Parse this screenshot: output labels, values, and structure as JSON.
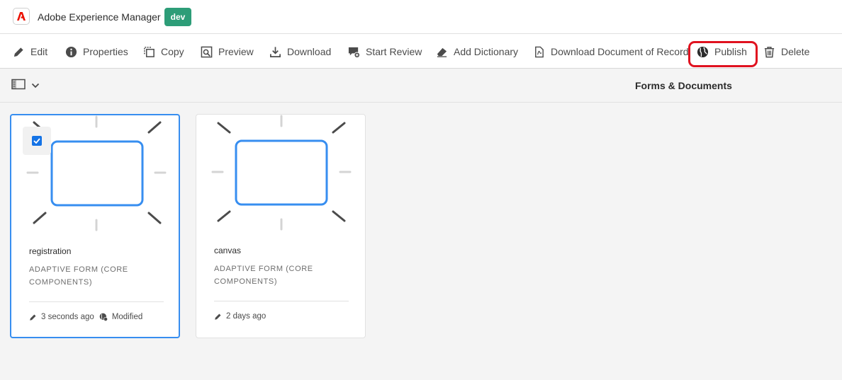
{
  "header": {
    "app_title": "Adobe Experience Manager",
    "env_badge": "dev",
    "logo_icon": "adobe-logo-icon",
    "brand_color": "#eb1000",
    "badge_color": "#2d9d78"
  },
  "actions": [
    {
      "label": "Edit",
      "icon": "pencil-icon"
    },
    {
      "label": "Properties",
      "icon": "info-icon"
    },
    {
      "label": "Copy",
      "icon": "copy-icon"
    },
    {
      "label": "Preview",
      "icon": "preview-icon"
    },
    {
      "label": "Download",
      "icon": "download-icon"
    },
    {
      "label": "Start Review",
      "icon": "review-icon"
    },
    {
      "label": "Add Dictionary",
      "icon": "eraser-icon"
    },
    {
      "label": "Download Document of Record",
      "icon": "document-icon"
    },
    {
      "label": "Publish",
      "icon": "globe-icon",
      "highlighted": true
    },
    {
      "label": "Delete",
      "icon": "trash-icon"
    }
  ],
  "highlight_color": "#e0121f",
  "railbar": {
    "section_title": "Forms & Documents"
  },
  "cards": [
    {
      "name": "registration",
      "type": "ADAPTIVE FORM (CORE COMPONENTS)",
      "modified_time": "3 seconds ago",
      "status": "Modified",
      "selected": true
    },
    {
      "name": "canvas",
      "type": "ADAPTIVE FORM (CORE COMPONENTS)",
      "modified_time": "2 days ago",
      "status": "",
      "selected": false
    }
  ],
  "selection_color": "#378ef0"
}
